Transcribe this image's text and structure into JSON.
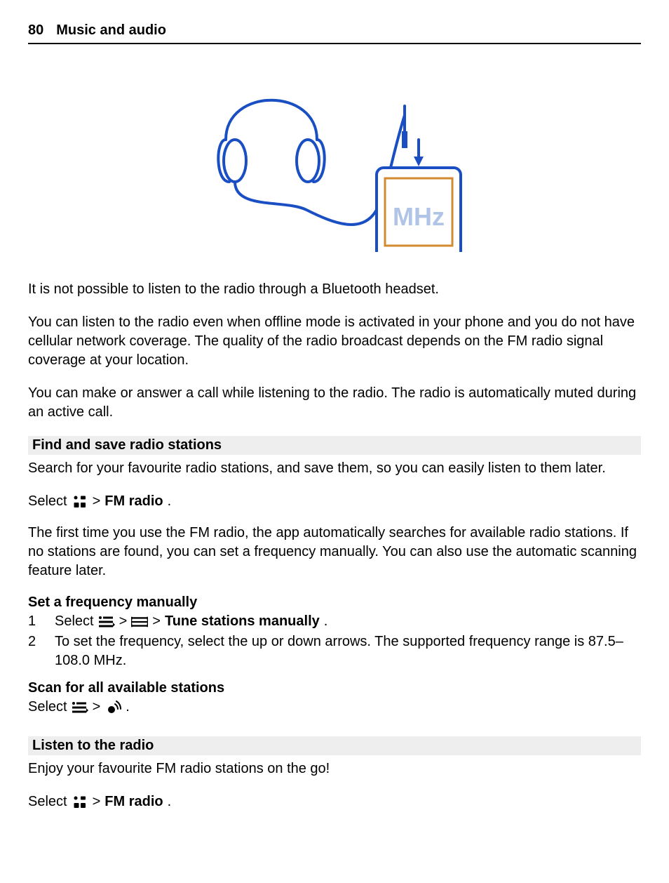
{
  "header": {
    "page_number": "80",
    "title": "Music and audio"
  },
  "illustration": {
    "phone_label": "MHz"
  },
  "para_bluetooth": "It is not possible to listen to the radio through a Bluetooth headset.",
  "para_offline": "You can listen to the radio even when offline mode is activated in your phone and you do not have cellular network coverage. The quality of the radio broadcast depends on the FM radio signal coverage at your location.",
  "para_call": "You can make or answer a call while listening to the radio. The radio is automatically muted during an active call.",
  "section_find": {
    "heading": "Find and save radio stations",
    "intro": "Search for your favourite radio stations, and save them, so you can easily listen to them later.",
    "select_prefix": "Select",
    "select_gt": ">",
    "select_bold": "FM radio",
    "select_period": ".",
    "first_time": "The first time you use the FM radio, the app automatically searches for available radio stations. If no stations are found, you can set a frequency manually. You can also use the automatic scanning feature later."
  },
  "sub_set_freq": {
    "heading": "Set a frequency manually",
    "item1": {
      "num": "1",
      "prefix": "Select",
      "gt1": ">",
      "gt2": ">",
      "bold": "Tune stations manually",
      "period": "."
    },
    "item2": {
      "num": "2",
      "text": "To set the frequency, select the up or down arrows. The supported frequency range is 87.5–108.0 MHz."
    }
  },
  "sub_scan": {
    "heading": "Scan for all available stations",
    "select_prefix": "Select",
    "gt": ">",
    "period": "."
  },
  "section_listen": {
    "heading": "Listen to the radio",
    "intro": "Enjoy your favourite FM radio stations on the go!",
    "select_prefix": "Select",
    "gt": ">",
    "bold": "FM radio",
    "period": "."
  }
}
